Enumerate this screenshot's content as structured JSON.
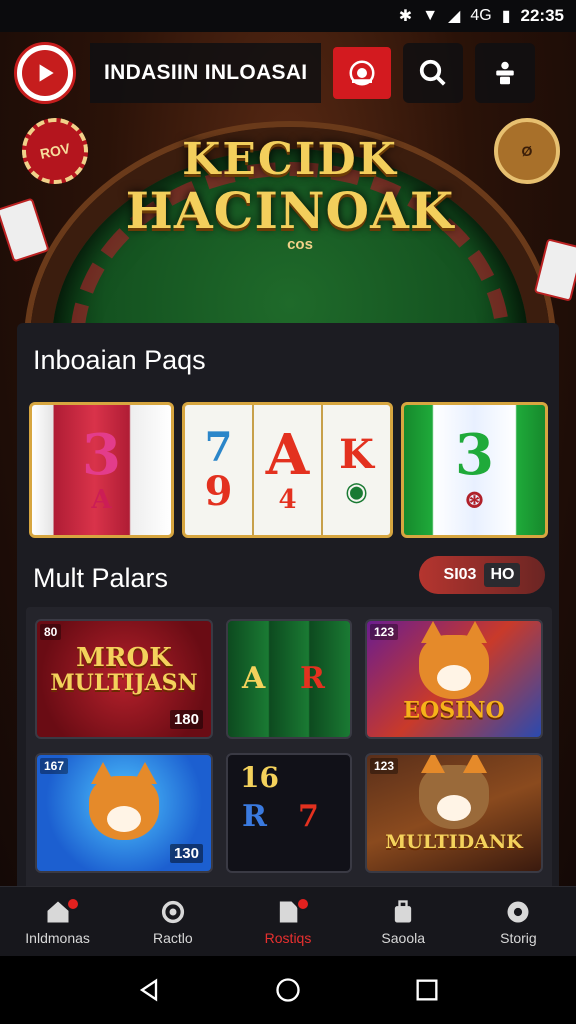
{
  "status_bar": {
    "time": "22:35",
    "icons": [
      "bluetooth-icon",
      "wifi-icon",
      "signal-icon",
      "battery-icon"
    ],
    "network_label": "4G"
  },
  "header": {
    "title": "INDASIIN INLOASAI"
  },
  "hero": {
    "title_line1": "KECIDK",
    "title_line2": "HACINOAK",
    "subtitle": "cos"
  },
  "hero_chips": {
    "left": "ROV",
    "right": "Ø"
  },
  "section1": {
    "title": "Inboaian Paqs"
  },
  "reels": [
    {
      "badge": "",
      "symbols": [
        "3",
        "A"
      ],
      "colors": [
        "#e33c8b",
        "#cc1d55"
      ]
    },
    {
      "badge": "",
      "symbols": [
        "7",
        "A",
        "K",
        "9",
        "4",
        "◉"
      ],
      "colors": [
        "#2b86c9",
        "#e3311f",
        "#e3311f"
      ]
    },
    {
      "badge": "",
      "symbols": [
        "3",
        "⊛"
      ],
      "colors": [
        "#1faa3a",
        "#b0202a"
      ]
    }
  ],
  "section2": {
    "title": "Mult Palars"
  },
  "sort": {
    "label": "SI03",
    "tag": "HO"
  },
  "tiles": [
    {
      "corner": "80",
      "name_line1": "MROK",
      "name_line2": "MULTIJASN",
      "num": "180"
    },
    {
      "corner": "",
      "name_line1": "A",
      "name_line2": "R",
      "num": ""
    },
    {
      "corner": "123",
      "name_line1": "EOSINO",
      "name_line2": "",
      "num": ""
    },
    {
      "corner": "167",
      "name_line1": "",
      "name_line2": "",
      "num": "130"
    },
    {
      "corner": "",
      "name_line1": "16",
      "name_line2": "R",
      "num": ""
    },
    {
      "corner": "123",
      "name_line1": "MULTIDANK",
      "name_line2": "",
      "num": ""
    }
  ],
  "bottom_nav": [
    {
      "label": "Inldmonas",
      "icon": "home-icon",
      "active": false,
      "badge": true
    },
    {
      "label": "Ractlo",
      "icon": "settings-icon",
      "active": false,
      "badge": false
    },
    {
      "label": "Rostiqs",
      "icon": "document-icon",
      "active": true,
      "badge": true
    },
    {
      "label": "Saoola",
      "icon": "bag-icon",
      "active": false,
      "badge": false
    },
    {
      "label": "Storig",
      "icon": "gear-icon",
      "active": false,
      "badge": false
    }
  ],
  "colors": {
    "accent": "#d31a1f",
    "panel": "#1c1c22",
    "gold": "#f3cf5c"
  }
}
